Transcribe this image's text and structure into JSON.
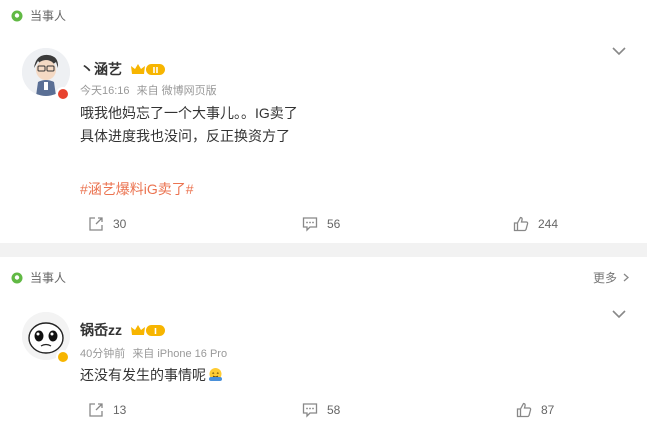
{
  "posts": [
    {
      "section_label": "当事人",
      "user": {
        "name": "丶涵艺",
        "vip_level": "II",
        "avatar": "cartoon-boy-avatar",
        "badge": "red-v-badge"
      },
      "meta": {
        "time": "今天16:16",
        "source": "来自 微博网页版"
      },
      "lines": [
        "哦我他妈忘了一个大事儿。。IG卖了",
        "具体进度我也没问，反正换资方了"
      ],
      "topic": "#涵艺爆料iG卖了#",
      "actions": {
        "share": "30",
        "comment": "56",
        "like": "244"
      }
    },
    {
      "section_label": "当事人",
      "more_label": "更多",
      "user": {
        "name": "锅岙zz",
        "vip_level": "I",
        "avatar": "cartoon-face-avatar",
        "badge": "yellow-v-badge"
      },
      "meta": {
        "time": "40分钟前",
        "source": "来自 iPhone 16 Pro"
      },
      "lines": [
        "还没有发生的事情呢"
      ],
      "emoji": "hug-emoji",
      "actions": {
        "share": "13",
        "comment": "58",
        "like": "87"
      }
    }
  ],
  "colors": {
    "topic": "#eb7350",
    "separator": "#f2f2f2",
    "pin": "#61b944",
    "vip_gold": "#f7b500"
  }
}
